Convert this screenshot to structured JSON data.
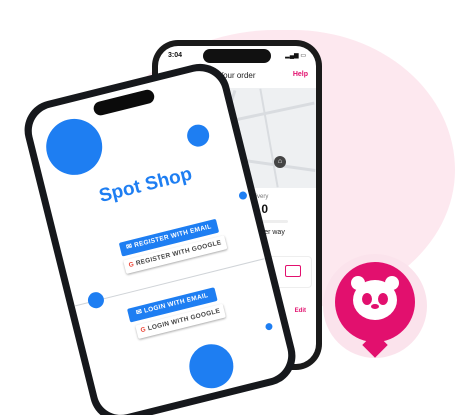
{
  "back_phone": {
    "status_time": "3:04",
    "header": {
      "back": "⌄",
      "title": "Your order",
      "help": "Help"
    },
    "delivery_label": "ted time of delivery",
    "delivery_time": "0 - 18:10",
    "progress": 0.55,
    "status_text": "Your order way",
    "edit": "Edit"
  },
  "front_phone": {
    "title": "Spot Shop",
    "register_email": "REGISTER WITH EMAIL",
    "register_google": "REGISTER WITH GOOGLE",
    "login_email": "LOGIN WITH EMAIL",
    "login_google": "LOGIN WITH GOOGLE",
    "google_glyph": "G",
    "mail_glyph": "✉"
  },
  "colors": {
    "accent_blue": "#1e7ef2",
    "accent_pink": "#e2106e"
  }
}
